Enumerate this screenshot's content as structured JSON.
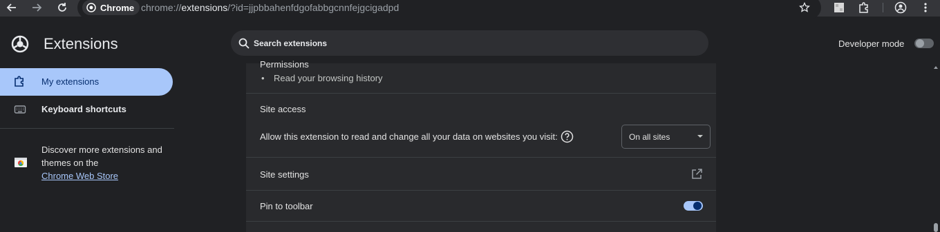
{
  "browser": {
    "site_chip": "Chrome",
    "url_prefix": "chrome://",
    "url_host": "extensions",
    "url_suffix": "/?id=jjpbbahenfdgofabbgcnnfejgcigadpd"
  },
  "header": {
    "title": "Extensions",
    "search_placeholder": "Search extensions",
    "developer_mode_label": "Developer mode",
    "developer_mode_on": false
  },
  "sidebar": {
    "items": [
      {
        "label": "My extensions",
        "icon": "extension-icon",
        "active": true
      },
      {
        "label": "Keyboard shortcuts",
        "icon": "keyboard-icon",
        "active": false
      }
    ],
    "discover_text": "Discover more extensions and themes on the",
    "store_link": "Chrome Web Store"
  },
  "details": {
    "permissions_title": "Permissions",
    "permissions": [
      "Read your browsing history"
    ],
    "site_access_title": "Site access",
    "site_access_text": "Allow this extension to read and change all your data on websites you visit:",
    "site_access_value": "On all sites",
    "site_settings_label": "Site settings",
    "pin_label": "Pin to toolbar",
    "pin_on": true
  },
  "colors": {
    "accent": "#a8c7fa",
    "background": "#202124",
    "card": "#292a2d"
  }
}
